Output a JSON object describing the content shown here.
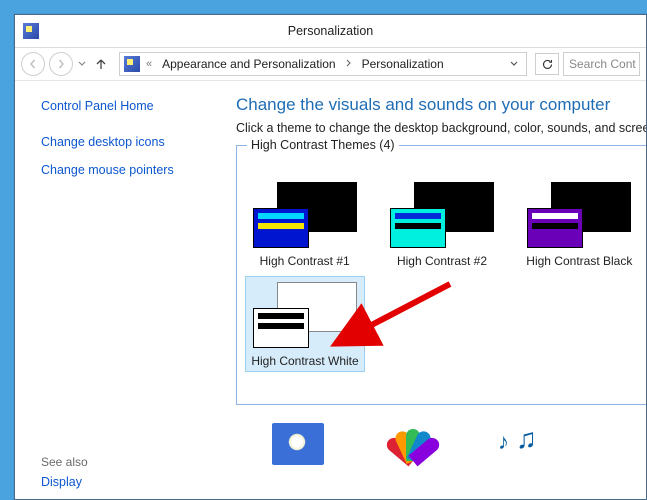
{
  "window": {
    "title": "Personalization"
  },
  "nav": {
    "breadcrumb_root_sep": "«",
    "crumb1": "Appearance and Personalization",
    "crumb2": "Personalization",
    "search_placeholder": "Search Cont"
  },
  "sidebar": {
    "home": "Control Panel Home",
    "link1": "Change desktop icons",
    "link2": "Change mouse pointers",
    "see_also": "See also",
    "display": "Display"
  },
  "content": {
    "title": "Change the visuals and sounds on your computer",
    "subtitle": "Click a theme to change the desktop background, color, sounds, and screen s",
    "group_label": "High Contrast Themes (4)",
    "themes": {
      "t1": "High Contrast #1",
      "t2": "High Contrast #2",
      "t3": "High Contrast Black",
      "t4": "High Contrast White"
    }
  }
}
